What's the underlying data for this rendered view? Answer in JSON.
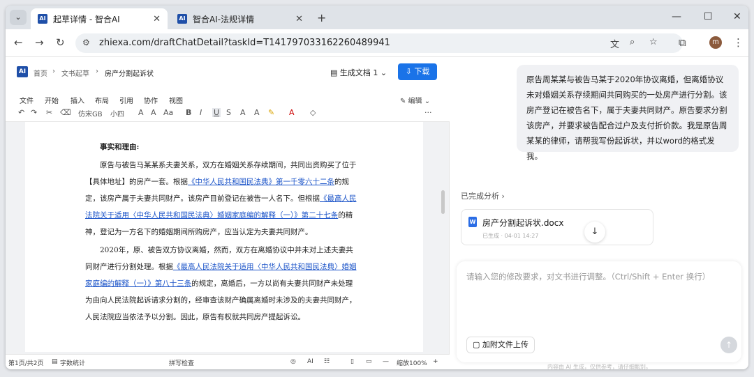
{
  "browser": {
    "tabs": [
      {
        "favicon": "AI",
        "title": "起草详情 - 智合AI",
        "active": true
      },
      {
        "favicon": "AI",
        "title": "智合AI-法规详情",
        "active": false
      }
    ],
    "url": "zhiexa.com/draftChatDetail?taskId=T1417970331622604899​41",
    "profile_initial": "m"
  },
  "editor": {
    "logo": "AI",
    "breadcrumb": [
      "首页",
      "文书起草",
      "房产分割起诉状"
    ],
    "generated_label": "生成文档 1",
    "download_label": "下载",
    "menus": [
      "文件",
      "开始",
      "插入",
      "布局",
      "引用",
      "协作",
      "视图"
    ],
    "active_menu": "开始",
    "edit_label": "编辑",
    "font_name": "仿宋GB",
    "font_size": "小四",
    "doc": {
      "heading": "事实和理由:",
      "para1_a": "原告与被告马某某系夫妻关系，双方在婚姻关系存续期间，共同出资购买了位于【具体地址】的房产一套。根据",
      "para1_link1": "《中华人民共和国民法典》第一千零六十二条",
      "para1_b": "的规定，该房产属于夫妻共同财产。该房产目前登记在被告一人名下。但根据",
      "para1_link2": "《最高人民法院关于适用〈中华人民共和国民法典〉婚姻家庭编的解释（一）》第二十七条",
      "para1_c": "的精神，登记为一方名下的婚姻期间所购房产，应当认定为夫妻共同财产。",
      "para2_a": "2020年，原、被告双方协议离婚，然而，双方在离婚协议中并未对上述夫妻共同财产进行分割处理。根据",
      "para2_link": "《最高人民法院关于适用〈中华人民共和国民法典〉婚姻家庭编的解释（一）》第八十三条",
      "para2_b": "的规定，离婚后，一方以尚有夫妻共同财产未处理为由向人民法院起诉请求分割的，经审查该财产确属离婚时未涉及的夫妻共同财产，人民法院应当依法予以分割。因此，原告有权就共同房产提起诉讼。"
    },
    "status": {
      "page": "第1页/共2页",
      "word_count": "字数统计",
      "spellcheck": "拼写检查",
      "zoom": "缩放100%"
    }
  },
  "chat": {
    "user_message": "原告周某某与被告马某于2020年协议离婚，但离婚协议未对婚姻关系存续期间共同购买的一处房产进行分割。该房产登记在被告名下，属于夫妻共同财产。原告要求分割该房产，并要求被告配合过户及支付折价款。我是原告周某某的律师，请帮我写份起诉状，并以word的格式发我。",
    "analysis_label": "已完成分析",
    "file": {
      "name": "房产分割起诉状.docx",
      "meta": "已生成 · 04-01 14:27"
    },
    "input_placeholder": "请输入您的修改要求，对文书进行调整。（Ctrl/Shift + Enter 换行）",
    "upload_label": "加附文件上传",
    "footer": "内容由 AI 生成，仅供参考，请仔细甄别。"
  }
}
